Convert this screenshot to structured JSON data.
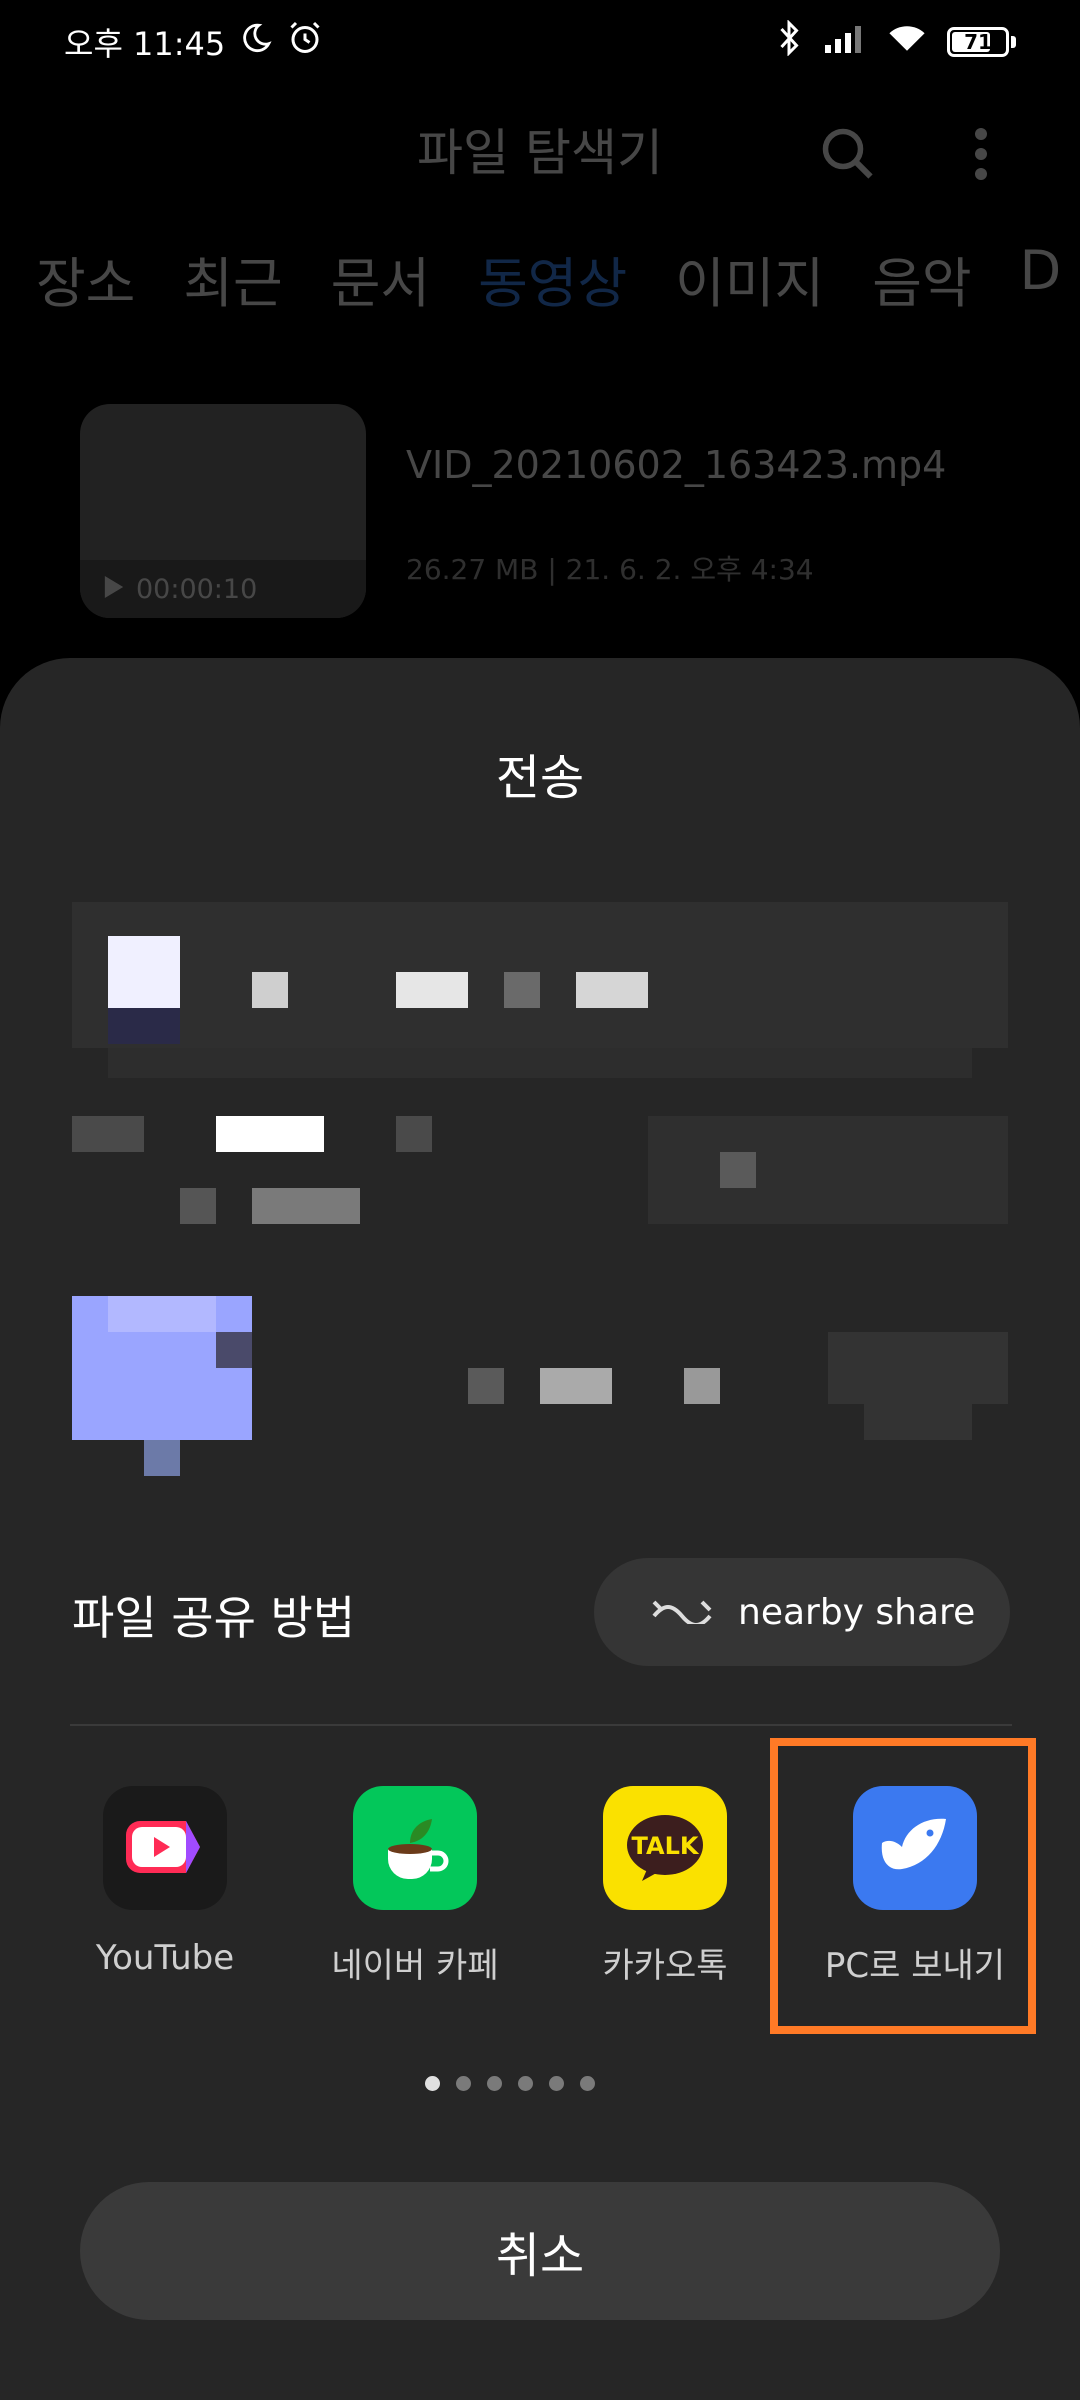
{
  "status_bar": {
    "time": "오후 11:45",
    "battery": "71",
    "icons": [
      "moon-icon",
      "alarm-icon",
      "bluetooth-icon",
      "signal-icon",
      "wifi-icon",
      "battery-icon"
    ]
  },
  "app_bar": {
    "title": "파일 탐색기",
    "icons": [
      "search-icon",
      "more-icon"
    ]
  },
  "tabs": [
    {
      "label": "장소",
      "active": false
    },
    {
      "label": "최근",
      "active": false
    },
    {
      "label": "문서",
      "active": false
    },
    {
      "label": "동영상",
      "active": true
    },
    {
      "label": "이미지",
      "active": false
    },
    {
      "label": "음악",
      "active": false
    },
    {
      "label": "D",
      "active": false
    }
  ],
  "file": {
    "name": "VID_20210602_163423.mp4",
    "duration": "00:00:10",
    "meta": "26.27 MB | 21. 6. 2. 오후 4:34"
  },
  "sheet": {
    "title": "전송",
    "share_label": "파일 공유 방법",
    "nearby_label": "nearby share",
    "apps": [
      {
        "label": "YouTube",
        "icon": "youtube-icon",
        "color": "#1a1a1a"
      },
      {
        "label": "네이버 카페",
        "icon": "naver-cafe-icon",
        "color": "#03c75a"
      },
      {
        "label": "카카오톡",
        "icon": "kakaotalk-icon",
        "color": "#fae100"
      },
      {
        "label": "PC로 보내기",
        "icon": "send-to-pc-icon",
        "color": "#3b79f0"
      }
    ],
    "highlight_color": "#ff7a26",
    "page_dots": 6,
    "active_dot": 0,
    "cancel_label": "취소"
  }
}
